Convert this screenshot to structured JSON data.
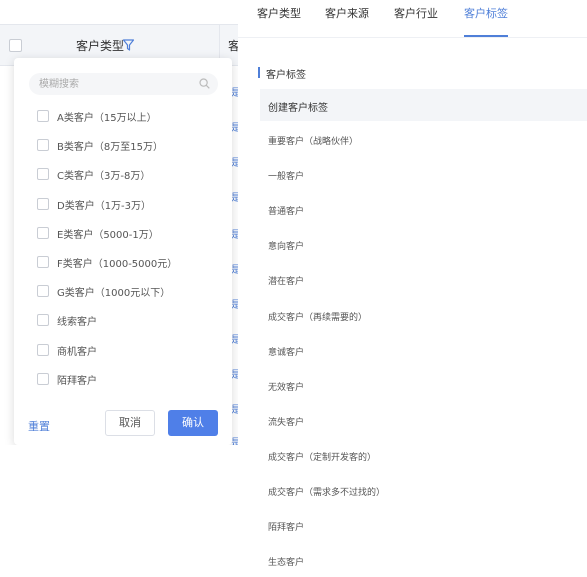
{
  "table": {
    "col_customer_type": "客户类型",
    "col_next": "客",
    "row_links": [
      "是",
      "是",
      "是",
      "是",
      "是",
      "是",
      "是",
      "是",
      "是",
      "是",
      "是"
    ]
  },
  "filter": {
    "search_placeholder": "模糊搜索",
    "options": [
      "A类客户（15万以上）",
      "B类客户（8万至15万）",
      "C类客户（3万-8万）",
      "D类客户（1万-3万）",
      "E类客户（5000-1万）",
      "F类客户（1000-5000元）",
      "G类客户（1000元以下）",
      "线索客户",
      "商机客户",
      "陌拜客户"
    ],
    "reset_label": "重置",
    "cancel_label": "取消",
    "confirm_label": "确认"
  },
  "tabs": [
    {
      "label": "客户类型",
      "active": false
    },
    {
      "label": "客户来源",
      "active": false
    },
    {
      "label": "客户行业",
      "active": false
    },
    {
      "label": "客户标签",
      "active": true
    }
  ],
  "tags": {
    "section_title": "客户标签",
    "header": "创建客户标签",
    "items": [
      "重要客户（战略伙伴）",
      "一般客户",
      "普通客户",
      "意向客户",
      "潜在客户",
      "成交客户（再续需要的）",
      "意诚客户",
      "无效客户",
      "流失客户",
      "成交客户（定制开发客的）",
      "成交客户（需求多不过找的）",
      "陌拜客户",
      "生态客户"
    ]
  },
  "colors": {
    "accent": "#4f7fd8",
    "confirm_bg": "#4f7fe8",
    "header_bg": "#f3f5f8"
  }
}
